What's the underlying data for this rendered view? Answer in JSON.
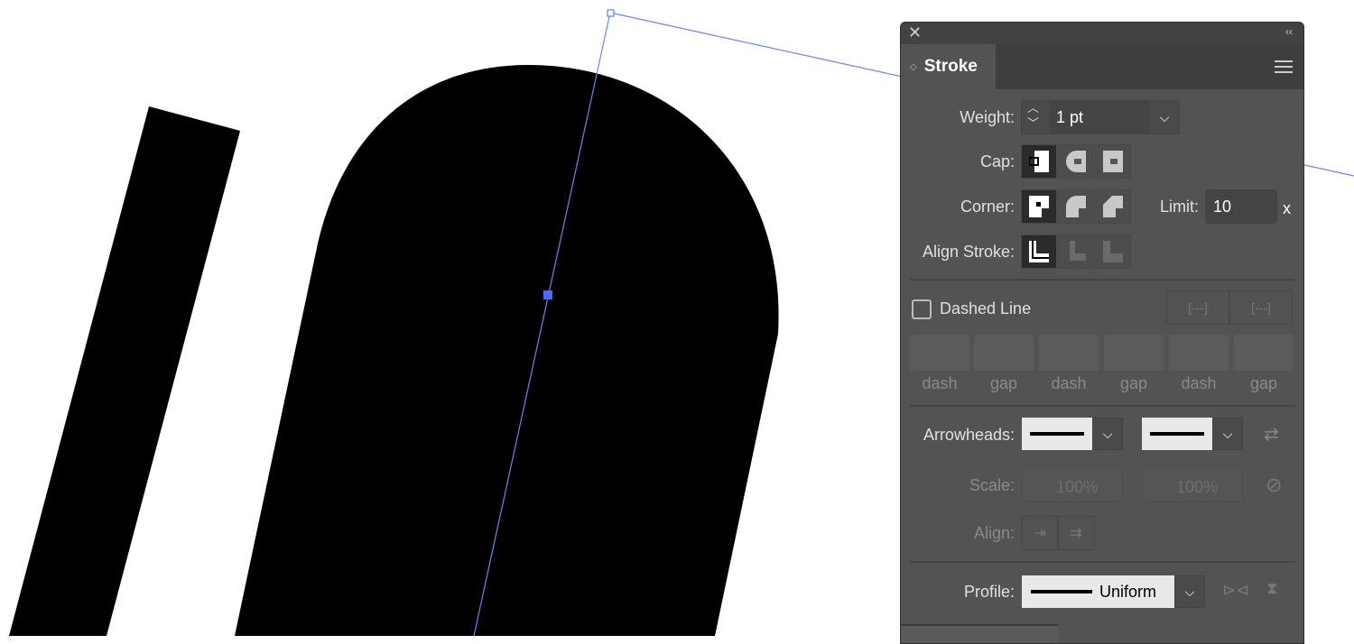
{
  "panel": {
    "title": "Stroke",
    "weight": {
      "label": "Weight:",
      "value": "1 pt"
    },
    "cap": {
      "label": "Cap:",
      "options": [
        "Butt Cap",
        "Round Cap",
        "Projecting Cap"
      ],
      "selected": 0
    },
    "corner": {
      "label": "Corner:",
      "options": [
        "Miter Join",
        "Round Join",
        "Bevel Join"
      ],
      "selected": 0
    },
    "limit": {
      "label": "Limit:",
      "value": "10",
      "suffix": "x"
    },
    "align_stroke": {
      "label": "Align Stroke:",
      "selected": 0
    },
    "dashed": {
      "label": "Dashed Line",
      "checked": false,
      "fields": [
        "dash",
        "gap",
        "dash",
        "gap",
        "dash",
        "gap"
      ]
    },
    "arrowheads": {
      "label": "Arrowheads:"
    },
    "scale": {
      "label": "Scale:",
      "start": "100%",
      "end": "100%"
    },
    "align": {
      "label": "Align:"
    },
    "profile": {
      "label": "Profile:",
      "value": "Uniform"
    }
  },
  "colors": {
    "selection": "#4a6cf7",
    "panel_bg": "#535353"
  }
}
